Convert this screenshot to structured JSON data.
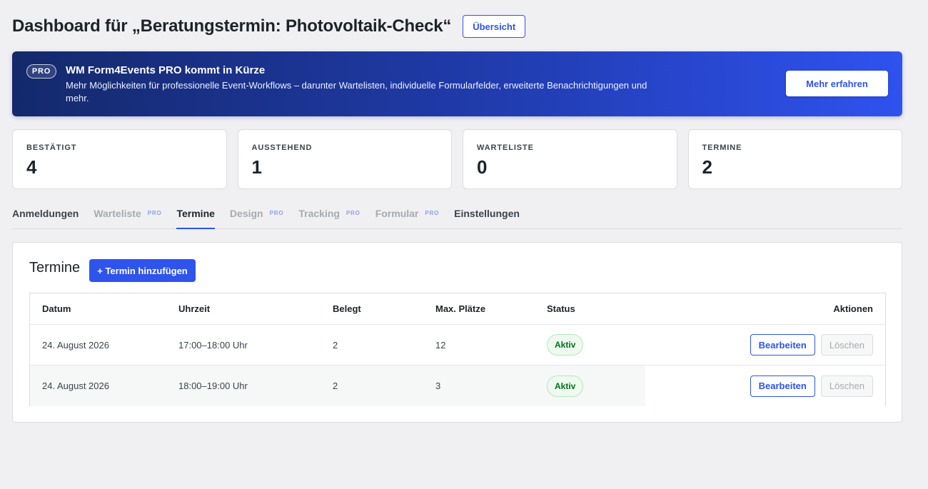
{
  "header": {
    "title": "Dashboard für „Beratungstermin: Photovoltaik-Check“",
    "overview_label": "Übersicht"
  },
  "banner": {
    "badge": "PRO",
    "title": "WM Form4Events PRO kommt in Kürze",
    "text": "Mehr Möglichkeiten für professionelle Event-Workflows – darunter Wartelisten, individuelle Formularfelder, erweiterte Benachrichtigungen und mehr.",
    "button_label": "Mehr erfahren"
  },
  "stats": [
    {
      "label": "BESTÄTIGT",
      "value": "4"
    },
    {
      "label": "AUSSTEHEND",
      "value": "1"
    },
    {
      "label": "WARTELISTE",
      "value": "0"
    },
    {
      "label": "TERMINE",
      "value": "2"
    }
  ],
  "tabs": [
    {
      "label": "Anmeldungen",
      "pro": ""
    },
    {
      "label": "Warteliste",
      "pro": "PRO"
    },
    {
      "label": "Termine",
      "pro": ""
    },
    {
      "label": "Design",
      "pro": "PRO"
    },
    {
      "label": "Tracking",
      "pro": "PRO"
    },
    {
      "label": "Formular",
      "pro": "PRO"
    },
    {
      "label": "Einstellungen",
      "pro": ""
    }
  ],
  "active_tab": "Termine",
  "panel": {
    "title": "Termine",
    "add_label": "+ Termin hinzufügen",
    "columns": {
      "datum": "Datum",
      "uhrzeit": "Uhrzeit",
      "belegt": "Belegt",
      "max": "Max. Plätze",
      "status": "Status",
      "aktionen": "Aktionen"
    },
    "rows": [
      {
        "datum": "24. August 2026",
        "uhrzeit": "17:00–18:00 Uhr",
        "belegt": "2",
        "max": "12",
        "status": "Aktiv",
        "edit": "Bearbeiten",
        "delete": "Löschen"
      },
      {
        "datum": "24. August 2026",
        "uhrzeit": "18:00–19:00 Uhr",
        "belegt": "2",
        "max": "3",
        "status": "Aktiv",
        "edit": "Bearbeiten",
        "delete": "Löschen"
      }
    ]
  },
  "colors": {
    "accent": "#2f54eb",
    "status_active": "#00701a",
    "banner_start": "#14296b",
    "banner_end": "#2f52f0"
  }
}
